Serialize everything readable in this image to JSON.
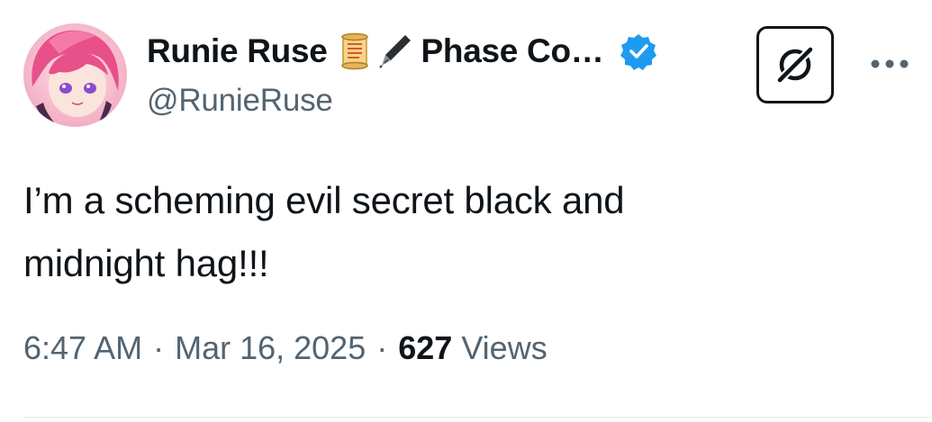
{
  "author": {
    "display_name": "Runie Ruse",
    "name_continuation": "Phase Co…",
    "handle": "@RunieRuse",
    "verified": true,
    "name_emojis": [
      "scroll-emoji",
      "fountain-pen-emoji"
    ]
  },
  "tweet": {
    "text": "I’m a scheming evil secret black and\nmidnight hag!!!"
  },
  "meta": {
    "time": "6:47 AM",
    "separator": "·",
    "date": "Mar 16, 2025",
    "views_count": "627",
    "views_label": "Views"
  },
  "actions": {
    "grok_icon": "grok-icon",
    "more_icon": "more-horizontal-icon"
  },
  "colors": {
    "text": "#0f1419",
    "secondary_text": "#536471",
    "verified_blue": "#1d9bf0",
    "divider": "#eff3f4"
  }
}
